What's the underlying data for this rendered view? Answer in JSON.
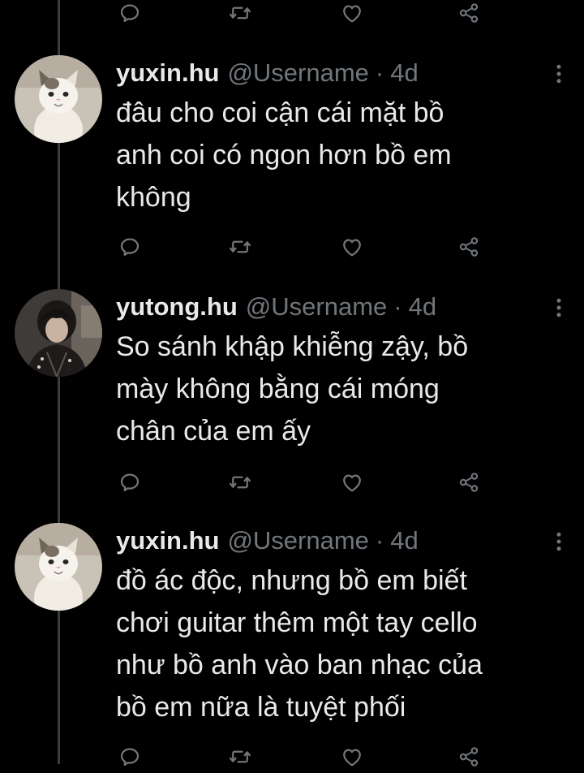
{
  "colors": {
    "background": "#000000",
    "text_primary": "#e7e9ea",
    "text_secondary": "#71767b",
    "thread_line": "#3a3d41"
  },
  "icons": {
    "reply": "speech-bubble-icon",
    "retweet": "retweet-icon",
    "like": "heart-icon",
    "share": "share-icon",
    "more": "vertical-dots-icon"
  },
  "tweets": [
    {
      "display_name": "yuxin.hu",
      "handle": "@Username",
      "separator": "·",
      "time": "4d",
      "lines": [
        "đâu cho coi cận cái mặt bồ",
        "anh coi có ngon hơn bồ em",
        "không"
      ]
    },
    {
      "display_name": "yutong.hu",
      "handle": "@Username",
      "separator": "·",
      "time": "4d",
      "lines": [
        "So sánh khập khiễng zậy, bồ",
        "mày không bằng cái móng",
        "chân của em ấy"
      ]
    },
    {
      "display_name": "yuxin.hu",
      "handle": "@Username",
      "separator": "·",
      "time": "4d",
      "lines": [
        "đồ ác độc, nhưng bồ em biết",
        "chơi guitar thêm một tay cello",
        "như bồ anh vào ban nhạc của",
        "bồ em nữa là tuyệt phối"
      ]
    }
  ]
}
